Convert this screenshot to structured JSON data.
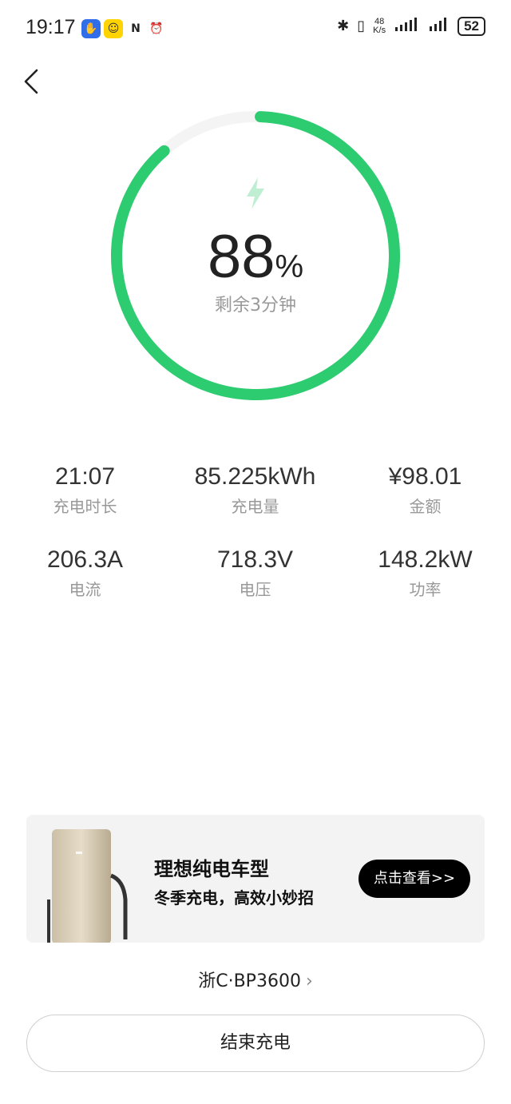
{
  "status_bar": {
    "time": "19:17",
    "speed_top": "48",
    "speed_bottom": "K/s",
    "battery": "52"
  },
  "charging": {
    "percent": "88",
    "percent_unit": "%",
    "percent_value": 0.88,
    "remaining": "剩余3分钟",
    "accent_color": "#2ecc71",
    "track_color": "#f4f4f4"
  },
  "stats": [
    {
      "value": "21:07",
      "label": "充电时长"
    },
    {
      "value": "85.225kWh",
      "label": "充电量"
    },
    {
      "value": "¥98.01",
      "label": "金额"
    },
    {
      "value": "206.3A",
      "label": "电流"
    },
    {
      "value": "718.3V",
      "label": "电压"
    },
    {
      "value": "148.2kW",
      "label": "功率"
    }
  ],
  "banner": {
    "title": "理想纯电车型",
    "subtitle": "冬季充电，高效小妙招",
    "button": "点击查看>>"
  },
  "plate": {
    "text": "浙C·BP3600",
    "chevron": "›"
  },
  "end_button": "结束充电"
}
